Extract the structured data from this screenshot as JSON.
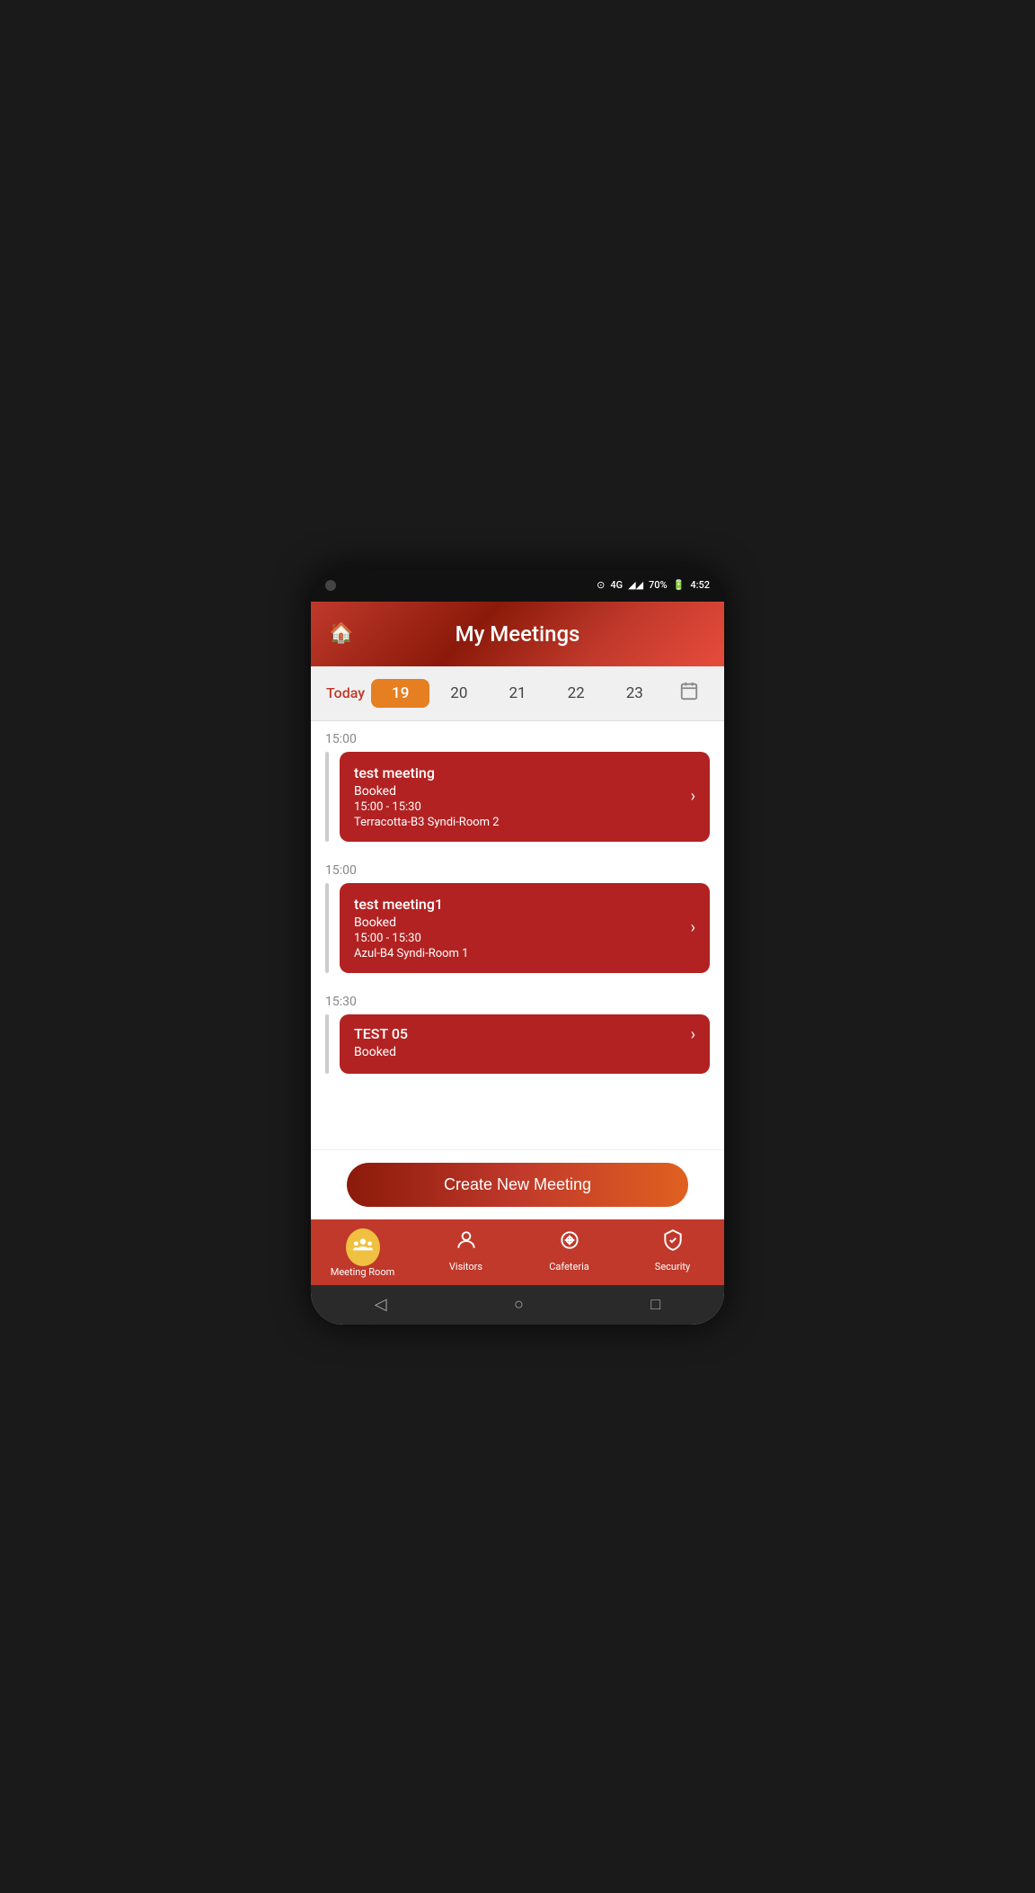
{
  "statusBar": {
    "network": "4G",
    "battery": "70%",
    "time": "4:52"
  },
  "header": {
    "title": "My Meetings",
    "homeIcon": "🏠"
  },
  "dateStrip": {
    "todayLabel": "Today",
    "dates": [
      {
        "day": "19",
        "active": true
      },
      {
        "day": "20",
        "active": false
      },
      {
        "day": "21",
        "active": false
      },
      {
        "day": "22",
        "active": false
      },
      {
        "day": "23",
        "active": false
      }
    ]
  },
  "meetings": [
    {
      "time": "15:00",
      "title": "test meeting",
      "status": "Booked",
      "timeRange": "15:00 - 15:30",
      "room": "Terracotta-B3 Syndi-Room 2"
    },
    {
      "time": "15:00",
      "title": "test meeting1",
      "status": "Booked",
      "timeRange": "15:00 - 15:30",
      "room": "Azul-B4 Syndi-Room 1"
    },
    {
      "time": "15:30",
      "title": "TEST 05",
      "status": "Booked",
      "timeRange": "",
      "room": ""
    }
  ],
  "createButton": {
    "label": "Create New Meeting"
  },
  "bottomNav": {
    "items": [
      {
        "label": "Meeting Room",
        "icon": "meeting-room",
        "active": true
      },
      {
        "label": "Visitors",
        "icon": "visitors",
        "active": false
      },
      {
        "label": "Cafeteria",
        "icon": "cafeteria",
        "active": false
      },
      {
        "label": "Security",
        "icon": "security",
        "active": false
      }
    ]
  },
  "androidNav": {
    "back": "◁",
    "home": "○",
    "recent": "□"
  }
}
